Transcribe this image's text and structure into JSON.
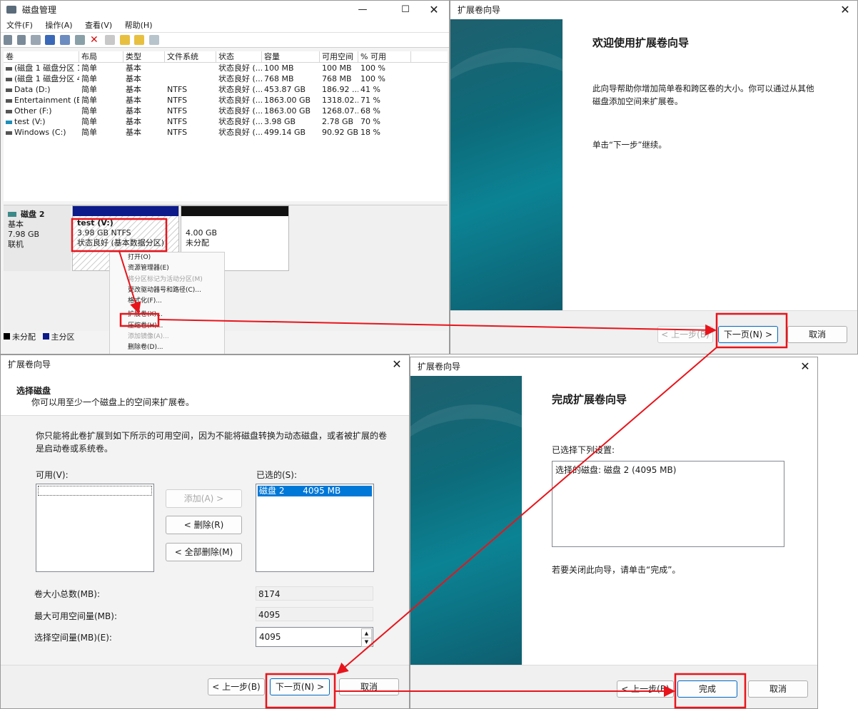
{
  "disk_mgmt": {
    "title": "磁盘管理",
    "menu": [
      "文件(F)",
      "操作(A)",
      "查看(V)",
      "帮助(H)"
    ],
    "columns": [
      "卷",
      "布局",
      "类型",
      "文件系统",
      "状态",
      "容量",
      "可用空间",
      "% 可用"
    ],
    "rows": [
      [
        "(磁盘 1 磁盘分区 1)",
        "简单",
        "基本",
        "",
        "状态良好 (...",
        "100 MB",
        "100 MB",
        "100 %"
      ],
      [
        "(磁盘 1 磁盘分区 4)",
        "简单",
        "基本",
        "",
        "状态良好 (...",
        "768 MB",
        "768 MB",
        "100 %"
      ],
      [
        "Data (D:)",
        "简单",
        "基本",
        "NTFS",
        "状态良好 (...",
        "453.87 GB",
        "186.92 ...",
        "41 %"
      ],
      [
        "Entertainment (E:)",
        "简单",
        "基本",
        "NTFS",
        "状态良好 (...",
        "1863.00 GB",
        "1318.02...",
        "71 %"
      ],
      [
        "Other (F:)",
        "简单",
        "基本",
        "NTFS",
        "状态良好 (...",
        "1863.00 GB",
        "1268.07...",
        "68 %"
      ],
      [
        "test (V:)",
        "简单",
        "基本",
        "NTFS",
        "状态良好 (...",
        "3.98 GB",
        "2.78 GB",
        "70 %"
      ],
      [
        "Windows (C:)",
        "简单",
        "基本",
        "NTFS",
        "状态良好 (...",
        "499.14 GB",
        "90.92 GB",
        "18 %"
      ]
    ],
    "disk": {
      "name": "磁盘 2",
      "type": "基本",
      "size": "7.98 GB",
      "status": "联机"
    },
    "part1": {
      "name": "test  (V:)",
      "size": "3.98 GB NTFS",
      "status": "状态良好 (基本数据分区)"
    },
    "part2": {
      "size": "4.00 GB",
      "status": "未分配"
    },
    "legend": {
      "unalloc": "未分配",
      "primary": "主分区"
    },
    "context_menu": [
      "打开(O)",
      "资源管理器(E)",
      "将分区标记为活动分区(M)",
      "更改驱动器号和路径(C)...",
      "格式化(F)...",
      "扩展卷(X)...",
      "压缩卷(H)...",
      "添加镜像(A)...",
      "删除卷(D)..."
    ]
  },
  "wizard1": {
    "title": "扩展卷向导",
    "heading": "欢迎使用扩展卷向导",
    "desc1": "此向导帮助你增加简单卷和跨区卷的大小。你可以通过从其他",
    "desc2": "磁盘添加空间来扩展卷。",
    "desc3": "单击“下一步”继续。",
    "back": "< 上一步(B)",
    "next": "下一页(N) >",
    "cancel": "取消"
  },
  "wizard2": {
    "title": "扩展卷向导",
    "heading": "选择磁盘",
    "subheading": "你可以用至少一个磁盘上的空间来扩展卷。",
    "info1": "你只能将此卷扩展到如下所示的可用空间，因为不能将磁盘转换为动态磁盘，或者被扩展的卷",
    "info2": "是启动卷或系统卷。",
    "available_label": "可用(V):",
    "selected_label": "已选的(S):",
    "selected_item_disk": "磁盘 2",
    "selected_item_size": "4095 MB",
    "add": "添加(A) >",
    "remove": "< 删除(R)",
    "remove_all": "< 全部删除(M)",
    "total_label": "卷大小总数(MB):",
    "total": "8174",
    "max_label": "最大可用空间量(MB):",
    "max": "4095",
    "select_label": "选择空间量(MB)(E):",
    "select": "4095",
    "back": "< 上一步(B)",
    "next": "下一页(N) >",
    "cancel": "取消"
  },
  "wizard3": {
    "title": "扩展卷向导",
    "heading": "完成扩展卷向导",
    "settings_label": "已选择下列设置:",
    "settings_text": "选择的磁盘: 磁盘 2 (4095 MB)",
    "close_hint": "若要关闭此向导，请单击“完成”。",
    "back": "< 上一步(B)",
    "finish": "完成",
    "cancel": "取消"
  },
  "colors": {
    "highlight": "#e8141b",
    "selection": "#0078d7",
    "primary_partition": "#0c1a8a"
  }
}
